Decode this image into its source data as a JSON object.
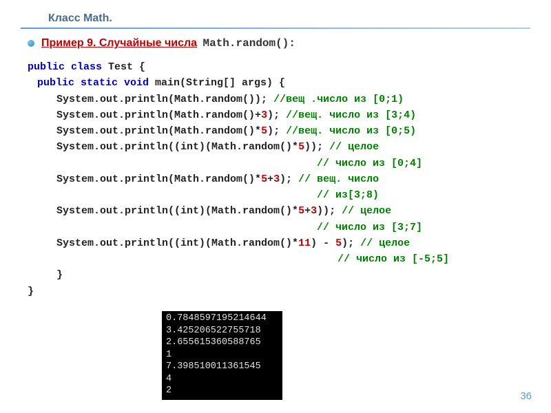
{
  "title": "Класс Math.",
  "example_label": "Пример 9. Случайные числа",
  "example_fn": "Math.random():",
  "code": {
    "l1a": "public class ",
    "l1b": "Test {",
    "l2a": "public static void ",
    "l2b": "main(String[] args) {",
    "l3a": "System.out.println(Math.random()); ",
    "l3b": "//вещ .число из [0;1)",
    "l4a": "System.out.println(Math.random()+",
    "l4n": "3",
    "l4c": "); ",
    "l4d": "//вещ. число из [3;4)",
    "l5a": "System.out.println(Math.random()*",
    "l5n": "5",
    "l5c": "); ",
    "l5d": "//вещ. число из [0;5)",
    "l6a": "System.out.println((int)(Math.random()*",
    "l6n": "5",
    "l6c": ")); ",
    "l6d": "// целое",
    "l6e": "// число из [0;4]",
    "l7a": "System.out.println(Math.random()*",
    "l7n1": "5",
    "l7b": "+",
    "l7n2": "3",
    "l7c": "); ",
    "l7d": "// вещ. число",
    "l7e": "// из[3;8)",
    "l8a": "System.out.println((int)(Math.random()*",
    "l8n1": "5",
    "l8b": "+",
    "l8n2": "3",
    "l8c": ")); ",
    "l8d": "// целое",
    "l8e": "// число из [3;7]",
    "l9a": "System.out.println((int)(Math.random()*",
    "l9n1": "11",
    "l9b": ") - ",
    "l9n2": "5",
    "l9c": "); ",
    "l9d": "// целое",
    "l9e": "// число из [-5;5]",
    "l10": "}",
    "l11": "}"
  },
  "output": {
    "o1": "0.7848597195214644",
    "o2": "3.425206522755718",
    "o3": "2.655615360588765",
    "o4": "1",
    "o5": "7.398510011361545",
    "o6": "4",
    "o7": "2"
  },
  "page_number": "36"
}
